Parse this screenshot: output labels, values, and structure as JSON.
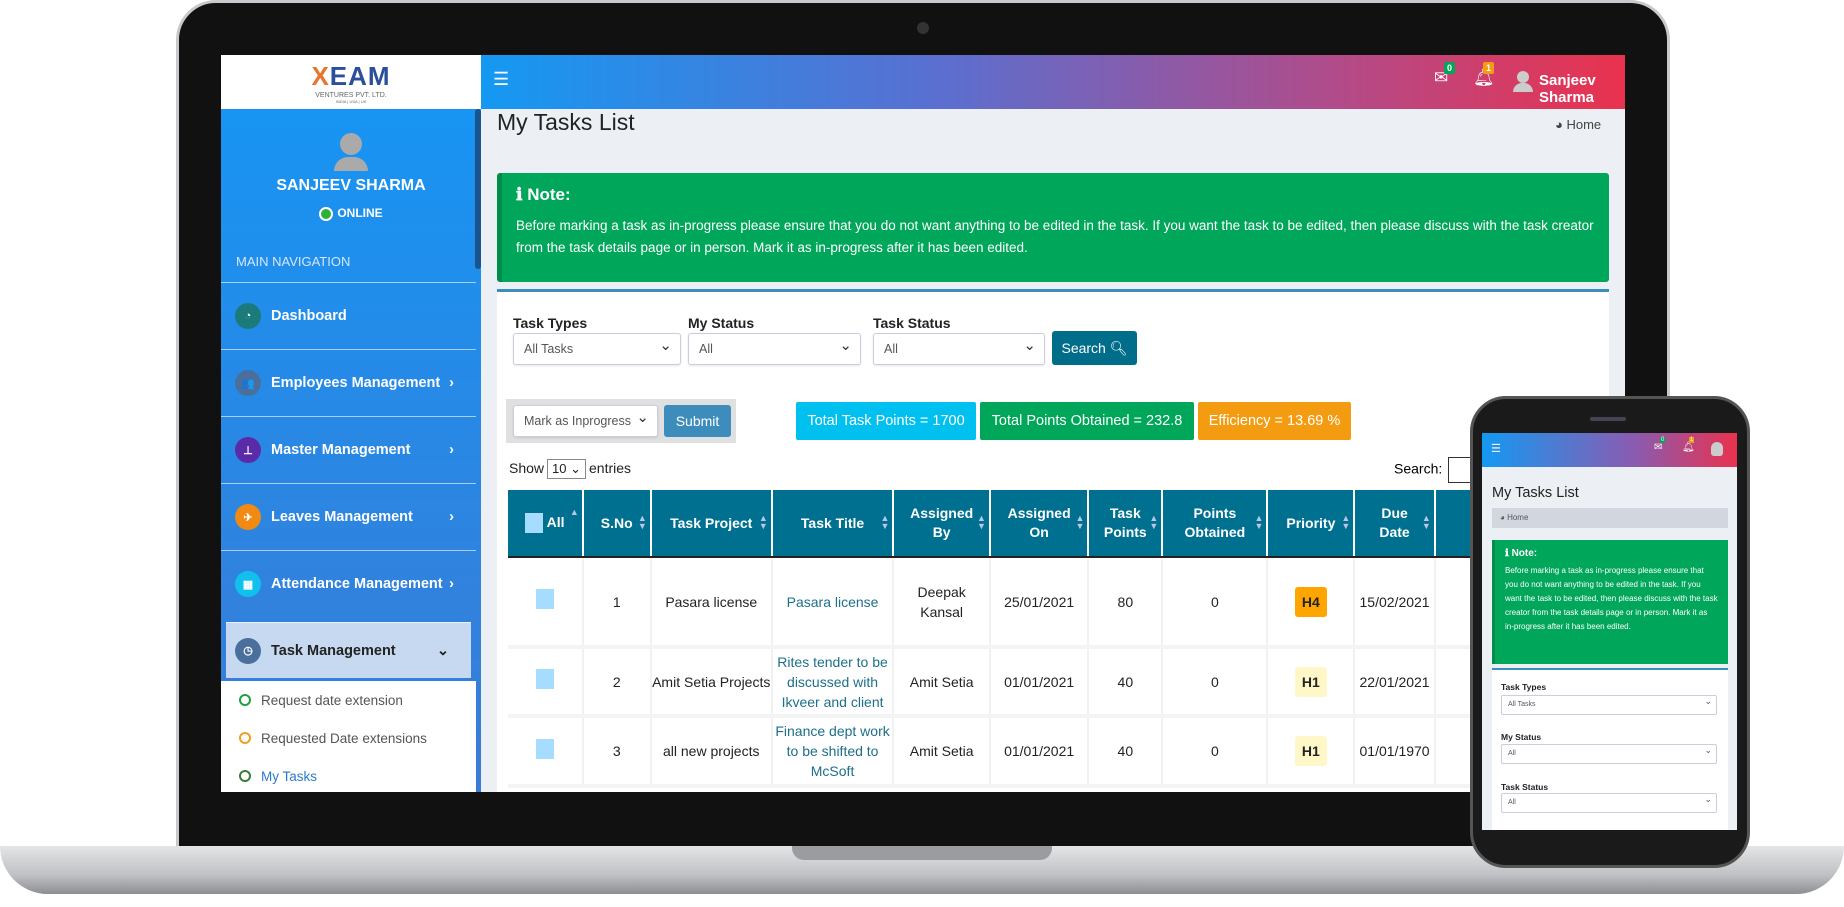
{
  "brand": {
    "logo_main": "XEAM",
    "logo_sub": "VENTURES PVT. LTD.",
    "logo_regions": "INDIA | USA | UK"
  },
  "user": {
    "name_upper": "SANJEEV SHARMA",
    "status": "ONLINE",
    "name": "Sanjeev Sharma"
  },
  "sidebar": {
    "section_label": "MAIN NAVIGATION",
    "items": [
      {
        "label": "Dashboard",
        "color": "#1b7a7a"
      },
      {
        "label": "Employees Management",
        "color": "#4a6f9c"
      },
      {
        "label": "Master Management",
        "color": "#5b2aa8"
      },
      {
        "label": "Leaves Management",
        "color": "#f08a12"
      },
      {
        "label": "Attendance Management",
        "color": "#12c0ee"
      },
      {
        "label": "Task Management",
        "color": "#4a6f9c"
      }
    ],
    "subitems": [
      {
        "label": "Request date extension",
        "color": "#20a040"
      },
      {
        "label": "Requested Date extensions",
        "color": "#f0a020"
      },
      {
        "label": "My Tasks",
        "color": "#3c7a3c"
      }
    ]
  },
  "header": {
    "mail_count": "0",
    "notif_count": "1"
  },
  "page": {
    "title": "My Tasks List",
    "breadcrumb": "Home"
  },
  "note": {
    "title": "Note:",
    "text": "Before marking a task as in-progress please ensure that you do not want anything to be edited in the task. If you want the task to be edited, then please discuss with the task creator from the task details page or in person. Mark it as in-progress after it has been edited."
  },
  "filters": {
    "task_types_label": "Task Types",
    "task_types_value": "All Tasks",
    "my_status_label": "My Status",
    "my_status_value": "All",
    "task_status_label": "Task Status",
    "task_status_value": "All",
    "search_button": "Search"
  },
  "bulk": {
    "action_value": "Mark as Inprogress",
    "submit": "Submit"
  },
  "stats": {
    "total_task_points": "Total Task Points = 1700",
    "total_points_obtained": "Total Points Obtained = 232.8",
    "efficiency": "Efficiency = 13.69 %"
  },
  "table_controls": {
    "show": "Show",
    "entries_value": "10",
    "entries": "entries",
    "search_label": "Search:"
  },
  "table": {
    "headers": [
      "All",
      "S.No",
      "Task Project",
      "Task Title",
      "Assigned By",
      "Assigned On",
      "Task Points",
      "Points Obtained",
      "Priority",
      "Due Date"
    ],
    "rows": [
      {
        "sno": "1",
        "project": "Pasara license",
        "title": "Pasara license",
        "assigned_by": "Deepak Kansal",
        "assigned_on": "25/01/2021",
        "points": "80",
        "obtained": "0",
        "priority": "H4",
        "priority_color": "#ffa500",
        "due": "15/02/2021"
      },
      {
        "sno": "2",
        "project": "Amit Setia Projects",
        "title": "Rites tender to be discussed with Ikveer and client",
        "assigned_by": "Amit Setia",
        "assigned_on": "01/01/2021",
        "points": "40",
        "obtained": "0",
        "priority": "H1",
        "priority_color": "#fff7c8",
        "due": "22/01/2021"
      },
      {
        "sno": "3",
        "project": "all new projects",
        "title": "Finance dept work to be shifted to McSoft",
        "assigned_by": "Amit Setia",
        "assigned_on": "01/01/2021",
        "points": "40",
        "obtained": "0",
        "priority": "H1",
        "priority_color": "#fff7c8",
        "due": "01/01/1970"
      }
    ]
  }
}
